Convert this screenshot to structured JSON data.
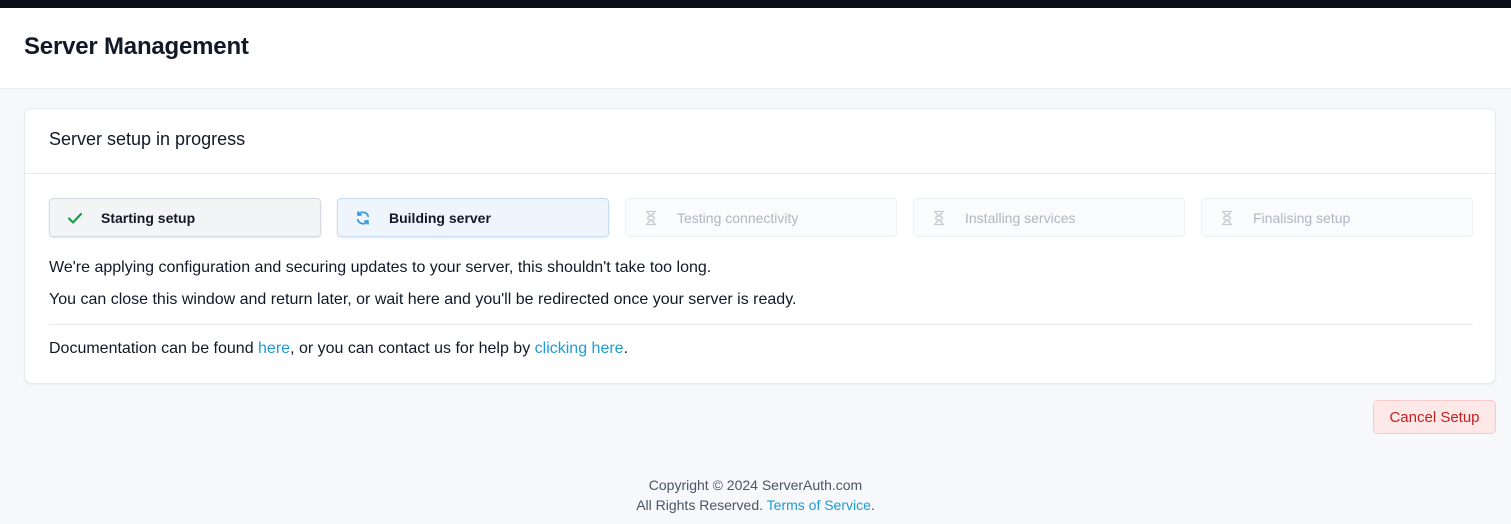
{
  "header": {
    "title": "Server Management"
  },
  "card": {
    "title": "Server setup in progress",
    "steps": [
      {
        "label": "Starting setup",
        "status": "done",
        "icon": "check-icon"
      },
      {
        "label": "Building server",
        "status": "active",
        "icon": "refresh-icon"
      },
      {
        "label": "Testing connectivity",
        "status": "pending",
        "icon": "hourglass-icon"
      },
      {
        "label": "Installing services",
        "status": "pending",
        "icon": "hourglass-icon"
      },
      {
        "label": "Finalising setup",
        "status": "pending",
        "icon": "hourglass-icon"
      }
    ],
    "message_line1": "We're applying configuration and securing updates to your server, this shouldn't take too long.",
    "message_line2": "You can close this window and return later, or wait here and you'll be redirected once your server is ready.",
    "docs": {
      "prefix": "Documentation can be found ",
      "docs_link": "here",
      "middle": ", or you can contact us for help by ",
      "contact_link": "clicking here",
      "suffix": "."
    }
  },
  "actions": {
    "cancel_label": "Cancel Setup"
  },
  "footer": {
    "copyright": "Copyright © 2024 ServerAuth.com",
    "rights": "All Rights Reserved. ",
    "terms_link": "Terms of Service",
    "terms_suffix": "."
  },
  "colors": {
    "accent_link": "#1e9bd7",
    "success": "#16a34a",
    "active_icon": "#3b9ad9",
    "danger": "#c81e1e"
  }
}
